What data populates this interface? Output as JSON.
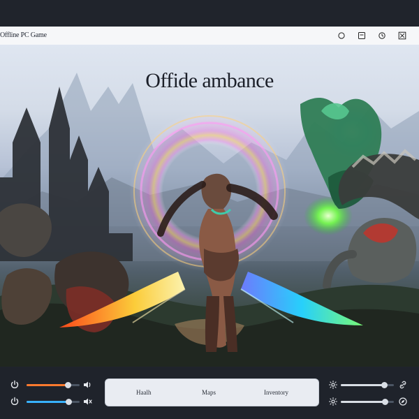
{
  "window": {
    "title": "Offline PC Game"
  },
  "scene": {
    "overlay_title": "Offide ambance"
  },
  "tabs": {
    "health": "Haalh",
    "maps": "Maps",
    "inventory": "Inventory"
  },
  "sliders": {
    "left_top": {
      "value": 0.78,
      "color": "#ff7a2e"
    },
    "left_bottom": {
      "value": 0.8,
      "color": "#38b2ff"
    },
    "right_top": {
      "value": 0.82,
      "color": "#d9dee5"
    },
    "right_bottom": {
      "value": 0.84,
      "color": "#d9dee5"
    }
  },
  "icons": {
    "titlebar": [
      "circle-icon",
      "window-icon",
      "clock-icon",
      "close-icon"
    ],
    "bottom_left": [
      "power-icon",
      "power-icon",
      "speaker-icon",
      "mute-icon"
    ],
    "bottom_right": [
      "settings-icon",
      "settings-icon",
      "link-icon",
      "compass-icon"
    ]
  }
}
